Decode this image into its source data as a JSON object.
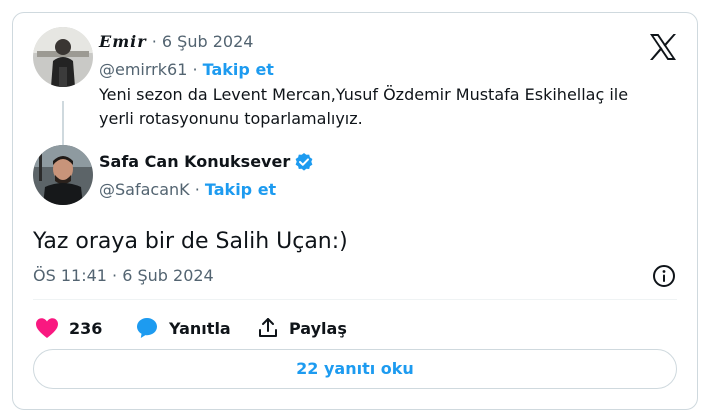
{
  "quoted_tweet": {
    "author_name": "Emir",
    "date": "· 6 Şub 2024",
    "handle": "@emirrk61",
    "follow_label": "Takip et",
    "text": "Yeni sezon da Levent Mercan,Yusuf Özdemir Mustafa Eskihellaç ile yerli rotasyonunu toparlamalıyız."
  },
  "main_tweet": {
    "author_name": "Safa Can Konuksever",
    "verified": true,
    "handle": "@SafacanK",
    "follow_label": "Takip et",
    "text": "Yaz oraya bir de Salih Uçan:)",
    "timestamp": "ÖS 11:41 · 6 Şub 2024"
  },
  "actions": {
    "like_count": "236",
    "reply_label": "Yanıtla",
    "share_label": "Paylaş"
  },
  "replies_button_label": "22 yanıtı oku",
  "icons": {
    "brand": "x-logo-icon",
    "verified": "verified-badge-icon",
    "info": "info-icon",
    "like": "heart-icon",
    "reply": "speech-bubble-icon",
    "share": "share-upload-icon"
  },
  "colors": {
    "accent": "#1d9bf0",
    "like": "#f91880",
    "muted": "#536471",
    "border": "#cfd9de"
  }
}
